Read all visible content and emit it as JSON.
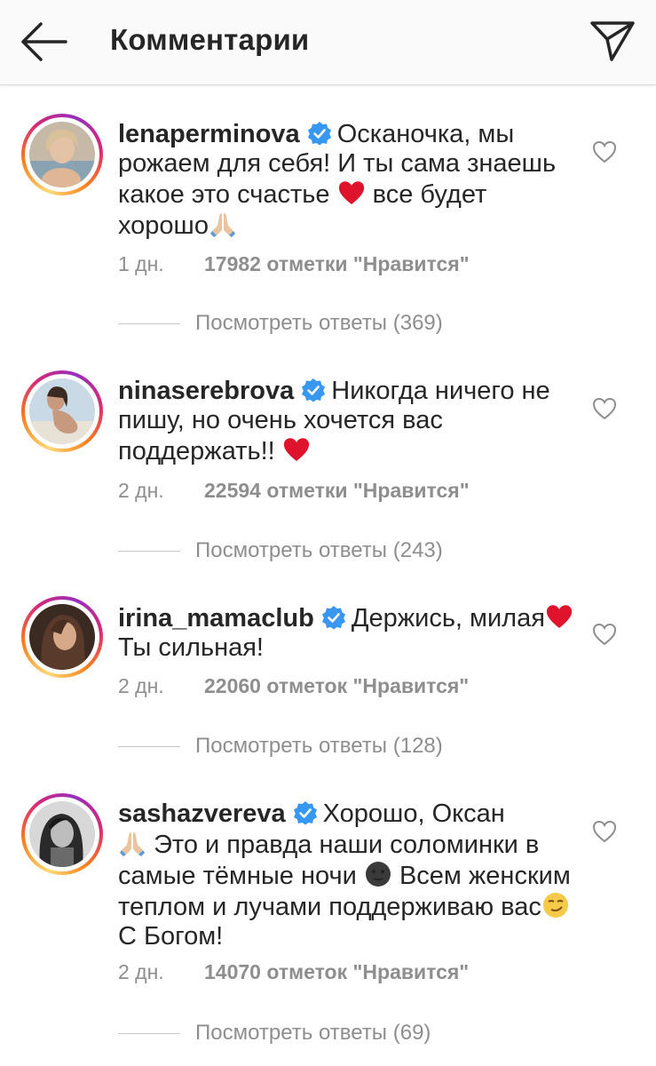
{
  "header": {
    "title": "Комментарии",
    "back_icon": "arrow-left-icon",
    "send_icon": "paper-plane-icon"
  },
  "colors": {
    "text": "#262626",
    "secondary": "#8e8e8e",
    "verified": "#3897f0",
    "heart": "#e0132c"
  },
  "comments": [
    {
      "username": "lenaperminova",
      "text_before": "Осканочка, мы рожаем для себя! И ты сама знаешь какое это счастье",
      "text_middle": "все будет хорошо",
      "time": "1 дн.",
      "likes": "17982 отметки \"Нравится\"",
      "replies": "Посмотреть ответы (369)"
    },
    {
      "username": "ninaserebrova",
      "text_before": "Никогда ничего не пишу, но очень хочется вас поддержать!!",
      "time": "2 дн.",
      "likes": "22594 отметки \"Нравится\"",
      "replies": "Посмотреть ответы (243)"
    },
    {
      "username": "irina_mamaclub",
      "text_before": "Держись, милая",
      "text_after": "Ты сильная!",
      "time": "2 дн.",
      "likes": "22060 отметок \"Нравится\"",
      "replies": "Посмотреть ответы (128)"
    },
    {
      "username": "sashazvereva",
      "text_before": "Хорошо, Оксан",
      "text_middle": "Это и правда наши соломинки в самые тёмные ночи",
      "text_middle2": "Всем женским теплом и лучами поддерживаю вас",
      "text_after": "С Богом!",
      "time": "2 дн.",
      "likes": "14070 отметок \"Нравится\"",
      "replies": "Посмотреть ответы (69)"
    }
  ]
}
